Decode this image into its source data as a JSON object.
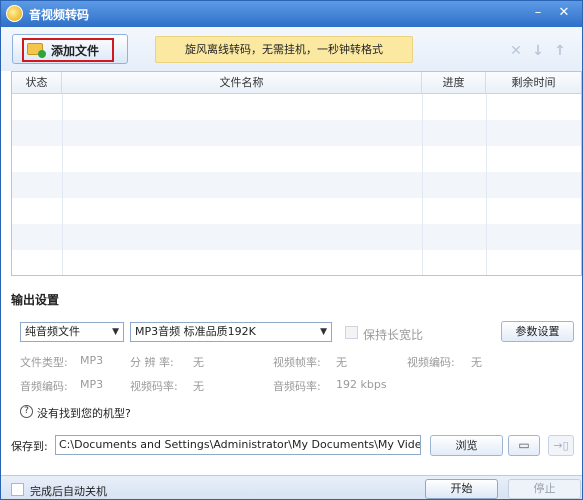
{
  "window": {
    "title": "音视频转码",
    "min_glyph": "–",
    "close_glyph": "✕"
  },
  "toolbar": {
    "add_file_label": "添加文件",
    "promo_text": "旋风离线转码，无需挂机，一秒钟转格式",
    "delete_glyph": "✕",
    "move_down_glyph": "↓",
    "move_up_glyph": "↑"
  },
  "file_table": {
    "columns": [
      "状态",
      "文件名称",
      "进度",
      "剩余时间"
    ]
  },
  "output_settings": {
    "section_title": "输出设置",
    "category_select": "纯音频文件",
    "format_select": "MP3音频 标准品质192K",
    "keep_aspect_label": "保持长宽比",
    "param_button": "参数设置",
    "info": {
      "file_type_label": "文件类型:",
      "file_type_value": "MP3",
      "resolution_label": "分 辨 率:",
      "resolution_value": "无",
      "video_fps_label": "视频帧率:",
      "video_fps_value": "无",
      "video_codec_label": "视频编码:",
      "video_codec_value": "无",
      "audio_codec_label": "音频编码:",
      "audio_codec_value": "MP3",
      "video_bitrate_label": "视频码率:",
      "video_bitrate_value": "无",
      "audio_bitrate_label": "音频码率:",
      "audio_bitrate_value": "192 kbps"
    },
    "help_text": "没有找到您的机型?"
  },
  "save": {
    "label": "保存到:",
    "path": "C:\\Documents and Settings\\Administrator\\My Documents\\My Vide",
    "browse_button": "浏览"
  },
  "footer": {
    "auto_shutdown_label": "完成后自动关机",
    "start_button": "开始",
    "stop_button": "停止"
  }
}
